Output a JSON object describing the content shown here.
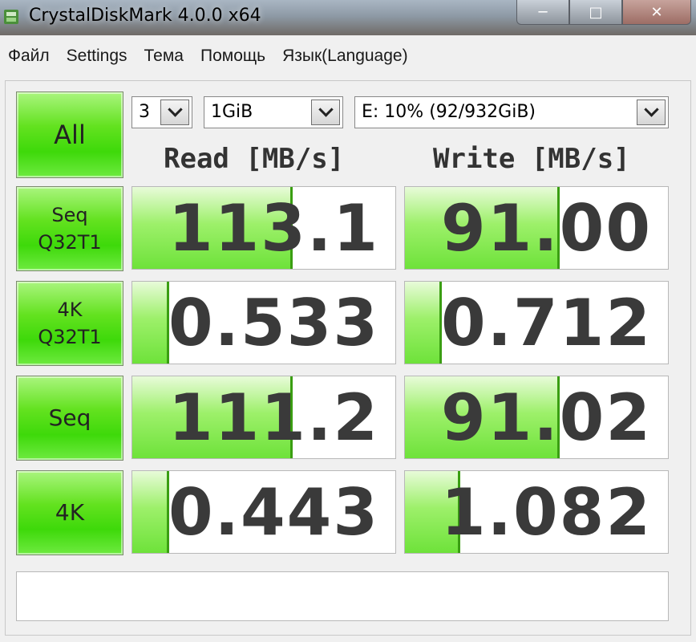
{
  "window": {
    "title": "CrystalDiskMark 4.0.0 x64",
    "controls": [
      "─",
      "□",
      "✕"
    ]
  },
  "menu": [
    "Файл",
    "Settings",
    "Тема",
    "Помощь",
    "Язык(Language)"
  ],
  "controls": {
    "all_label": "All",
    "count": "3",
    "size": "1GiB",
    "drive": "E: 10% (92/932GiB)"
  },
  "headers": {
    "read": "Read [MB/s]",
    "write": "Write [MB/s]"
  },
  "tests": [
    {
      "label_line1": "Seq",
      "label_line2": "Q32T1",
      "read": "113.1",
      "write": "91.00",
      "read_fill": 0.6,
      "write_fill": 0.58
    },
    {
      "label_line1": "4K",
      "label_line2": "Q32T1",
      "read": "0.533",
      "write": "0.712",
      "read_fill": 0.13,
      "write_fill": 0.13
    },
    {
      "label_line1": "Seq",
      "label_line2": "",
      "read": "111.2",
      "write": "91.02",
      "read_fill": 0.6,
      "write_fill": 0.58
    },
    {
      "label_line1": "4K",
      "label_line2": "",
      "read": "0.443",
      "write": "1.082",
      "read_fill": 0.13,
      "write_fill": 0.2
    }
  ],
  "status": "",
  "colors": {
    "button_green": "#3ed90a",
    "bar_green": "#6ee23a",
    "value_text": "#3a3a3a"
  }
}
